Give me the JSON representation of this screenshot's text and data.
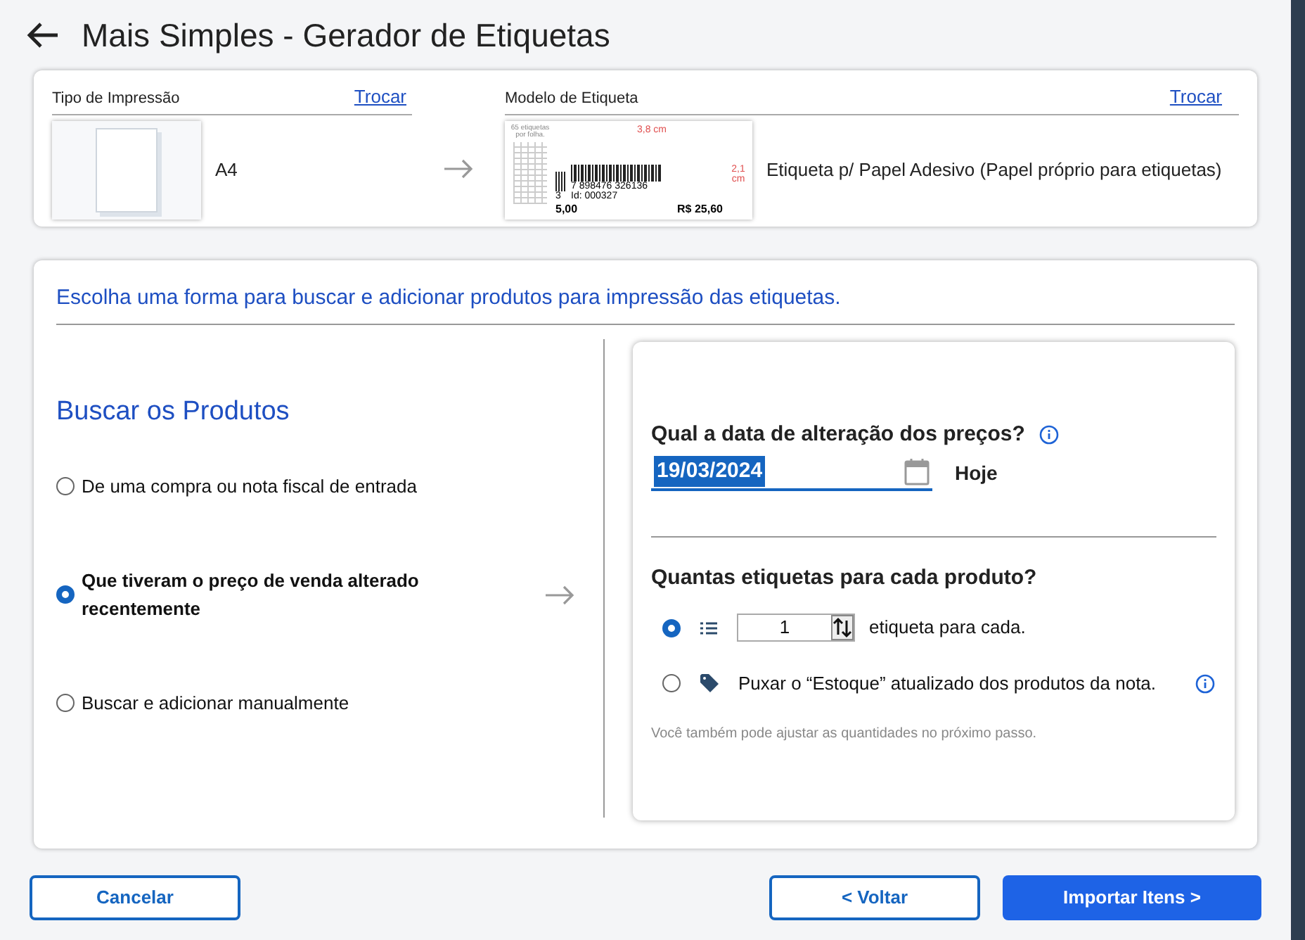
{
  "window": {
    "title": "Mais Simples - Gerador de Etiquetas"
  },
  "print_type": {
    "heading": "Tipo de Impressão",
    "change_link": "Trocar",
    "value": "A4"
  },
  "label_model": {
    "heading": "Modelo de Etiqueta",
    "change_link": "Trocar",
    "value": "Etiqueta p/ Papel Adesivo (Papel próprio para etiquetas)",
    "preview": {
      "sheet_note": "65 etiquetas por folha.",
      "width": "3,8 cm",
      "height": "2,1 cm",
      "small_code": "3",
      "barcode": "7 898476 326136",
      "id": "Id: 000327",
      "left_price": "5,00",
      "price": "R$ 25,60"
    }
  },
  "instructions": "Escolha uma forma para buscar e adicionar produtos para impressão das etiquetas.",
  "search": {
    "title": "Buscar os Produtos",
    "options": [
      {
        "label": "De uma compra ou nota fiscal de entrada",
        "selected": false
      },
      {
        "label": "Que tiveram o preço de venda alterado recentemente",
        "selected": true
      },
      {
        "label": "Buscar e adicionar manualmente",
        "selected": false
      }
    ]
  },
  "details": {
    "date_question": "Qual a data de alteração dos preços?",
    "date_value": "19/03/2024",
    "today_label": "Hoje",
    "quantity_question": "Quantas etiquetas para cada produto?",
    "quantity_options": [
      {
        "kind": "count",
        "value": "1",
        "suffix": "etiqueta para cada.",
        "selected": true
      },
      {
        "kind": "stock",
        "label": "Puxar o “Estoque” atualizado dos produtos da nota.",
        "selected": false
      }
    ],
    "hint": "Você também pode ajustar as quantidades no próximo passo."
  },
  "buttons": {
    "cancel": "Cancelar",
    "back": "< Voltar",
    "import": "Importar Itens >"
  }
}
